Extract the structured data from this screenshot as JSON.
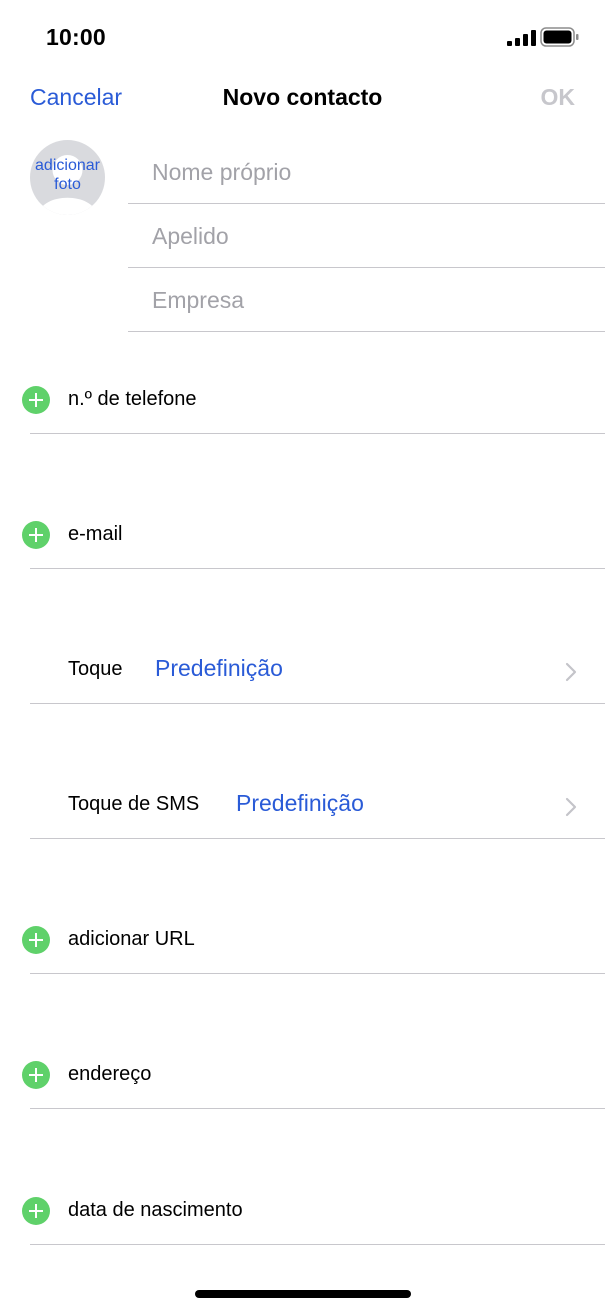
{
  "status_bar": {
    "time": "10:00",
    "signal_icon": "cellular-signal-icon",
    "battery_icon": "battery-icon"
  },
  "nav": {
    "cancel_label": "Cancelar",
    "title": "Novo contacto",
    "ok_label": "OK"
  },
  "avatar": {
    "line1": "adicionar",
    "line2": "foto",
    "icon": "person-silhouette-icon"
  },
  "name_fields": {
    "first_name_placeholder": "Nome próprio",
    "last_name_placeholder": "Apelido",
    "company_placeholder": "Empresa"
  },
  "rows": {
    "phone": "n.º de telefone",
    "email": "e-mail",
    "ringtone_label": "Toque",
    "ringtone_value": "Predefinição",
    "text_tone_label": "Toque de SMS",
    "text_tone_value": "Predefinição",
    "url": "adicionar URL",
    "address": "endereço",
    "birthday": "data de nascimento"
  },
  "colors": {
    "accent": "#2a5bd7",
    "add_green": "#5fd16a",
    "disabled": "#c7c7cc",
    "placeholder": "#a2a2a8",
    "separator": "#c8c7cc"
  }
}
